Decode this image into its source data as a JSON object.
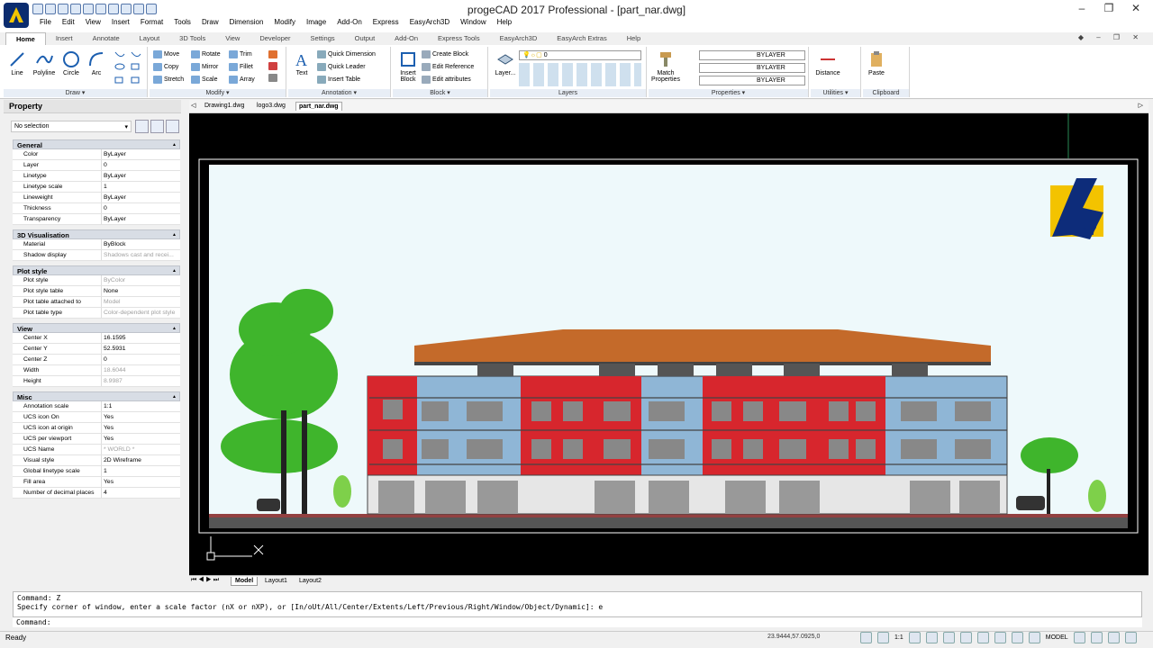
{
  "app": {
    "title": "progeCAD 2017 Professional - [part_nar.dwg]"
  },
  "menu": [
    "File",
    "Edit",
    "View",
    "Insert",
    "Format",
    "Tools",
    "Draw",
    "Dimension",
    "Modify",
    "Image",
    "Add-On",
    "Express",
    "EasyArch3D",
    "Window",
    "Help"
  ],
  "ribbon_tabs": [
    "Home",
    "Insert",
    "Annotate",
    "Layout",
    "3D Tools",
    "View",
    "Developer",
    "Settings",
    "Output",
    "Add-On",
    "Express Tools",
    "EasyArch3D",
    "EasyArch Extras",
    "Help"
  ],
  "draw": {
    "label": "Draw ▾",
    "line": "Line",
    "polyline": "Polyline",
    "circle": "Circle",
    "arc": "Arc"
  },
  "modify": {
    "label": "Modify ▾",
    "move": "Move",
    "rotate": "Rotate",
    "trim": "Trim",
    "copy": "Copy",
    "mirror": "Mirror",
    "fillet": "Fillet",
    "stretch": "Stretch",
    "scale": "Scale",
    "array": "Array"
  },
  "annotation": {
    "label": "Annotation ▾",
    "text": "Text",
    "quick_dimension": "Quick Dimension",
    "quick_leader": "Quick Leader",
    "insert_table": "Insert Table"
  },
  "block": {
    "label": "Block ▾",
    "insert_block": "Insert Block",
    "create_block": "Create Block",
    "edit_reference": "Edit Reference",
    "edit_attributes": "Edit attributes"
  },
  "layers": {
    "label": "Layers",
    "layer_btn": "Layer...",
    "current": "0"
  },
  "properties": {
    "label": "Properties ▾",
    "match": "Match Properties",
    "color": "BYLAYER",
    "linetype": "BYLAYER",
    "lineweight": "BYLAYER"
  },
  "utilities": {
    "label": "Utilities ▾",
    "distance": "Distance"
  },
  "clipboard": {
    "label": "Clipboard",
    "paste": "Paste"
  },
  "property_panel": {
    "title": "Property",
    "selection": "No selection",
    "sections": [
      {
        "name": "General",
        "rows": [
          {
            "k": "Color",
            "v": "ByLayer"
          },
          {
            "k": "Layer",
            "v": "0"
          },
          {
            "k": "Linetype",
            "v": "ByLayer"
          },
          {
            "k": "Linetype scale",
            "v": "1"
          },
          {
            "k": "Lineweight",
            "v": "ByLayer"
          },
          {
            "k": "Thickness",
            "v": "0"
          },
          {
            "k": "Transparency",
            "v": "ByLayer"
          }
        ]
      },
      {
        "name": "3D Visualisation",
        "rows": [
          {
            "k": "Material",
            "v": "ByBlock"
          },
          {
            "k": "Shadow display",
            "v": "Shadows cast and recei...",
            "grey": true
          }
        ]
      },
      {
        "name": "Plot style",
        "rows": [
          {
            "k": "Plot style",
            "v": "ByColor",
            "grey": true
          },
          {
            "k": "Plot style table",
            "v": "None"
          },
          {
            "k": "Plot table attached to",
            "v": "Model",
            "grey": true
          },
          {
            "k": "Plot table type",
            "v": "Color-dependent plot style",
            "grey": true
          }
        ]
      },
      {
        "name": "View",
        "rows": [
          {
            "k": "Center X",
            "v": "16.1595"
          },
          {
            "k": "Center Y",
            "v": "52.5931"
          },
          {
            "k": "Center Z",
            "v": "0"
          },
          {
            "k": "Width",
            "v": "18.6044",
            "grey": true
          },
          {
            "k": "Height",
            "v": "8.9987",
            "grey": true
          }
        ]
      },
      {
        "name": "Misc",
        "rows": [
          {
            "k": "Annotation scale",
            "v": "1:1"
          },
          {
            "k": "UCS icon On",
            "v": "Yes"
          },
          {
            "k": "UCS icon at origin",
            "v": "Yes"
          },
          {
            "k": "UCS per viewport",
            "v": "Yes"
          },
          {
            "k": "UCS Name",
            "v": "* WORLD *",
            "grey": true
          },
          {
            "k": "Visual style",
            "v": "2D Wireframe"
          },
          {
            "k": "Global linetype scale",
            "v": "1"
          },
          {
            "k": "Fill area",
            "v": "Yes"
          },
          {
            "k": "Number of decimal places",
            "v": "4"
          }
        ]
      }
    ]
  },
  "doc_tabs": [
    "Drawing1.dwg",
    "logo3.dwg",
    "part_nar.dwg"
  ],
  "layout_tabs": [
    "Model",
    "Layout1",
    "Layout2"
  ],
  "command": {
    "line1": "Command: Z",
    "line2": "Specify corner of window, enter a scale factor (nX or nXP), or [In/oUt/All/Center/Extents/Left/Previous/Right/Window/Object/Dynamic]: e",
    "prompt": "Command:"
  },
  "status": {
    "ready": "Ready",
    "coords": "23.9444,57.0925,0",
    "scale": "1:1",
    "model": "MODEL"
  },
  "colors": {
    "red": "#d7262d",
    "blue": "#8fb6d6",
    "roof": "#c46a2a",
    "tree": "#3fb52c"
  }
}
